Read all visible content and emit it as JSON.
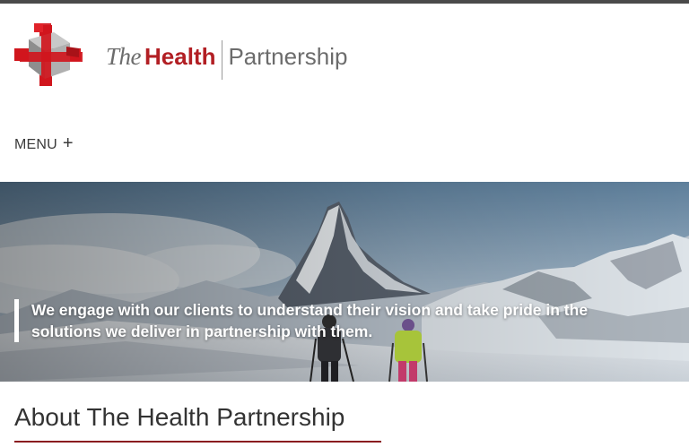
{
  "header": {
    "logo": {
      "the": "The",
      "health": "Health",
      "partnership": "Partnership"
    }
  },
  "nav": {
    "menu_label": "MENU",
    "menu_icon": "+"
  },
  "hero": {
    "quote": "We engage with our clients to understand their vision and take pride in the solutions we deliver in partnership with them."
  },
  "about": {
    "title": "About The Health Partnership"
  },
  "colors": {
    "brand_red": "#b21f24",
    "logo_grey": "#6c6c6c",
    "top_bar": "#4a4a4a",
    "heading_underline": "#8a1c20"
  }
}
